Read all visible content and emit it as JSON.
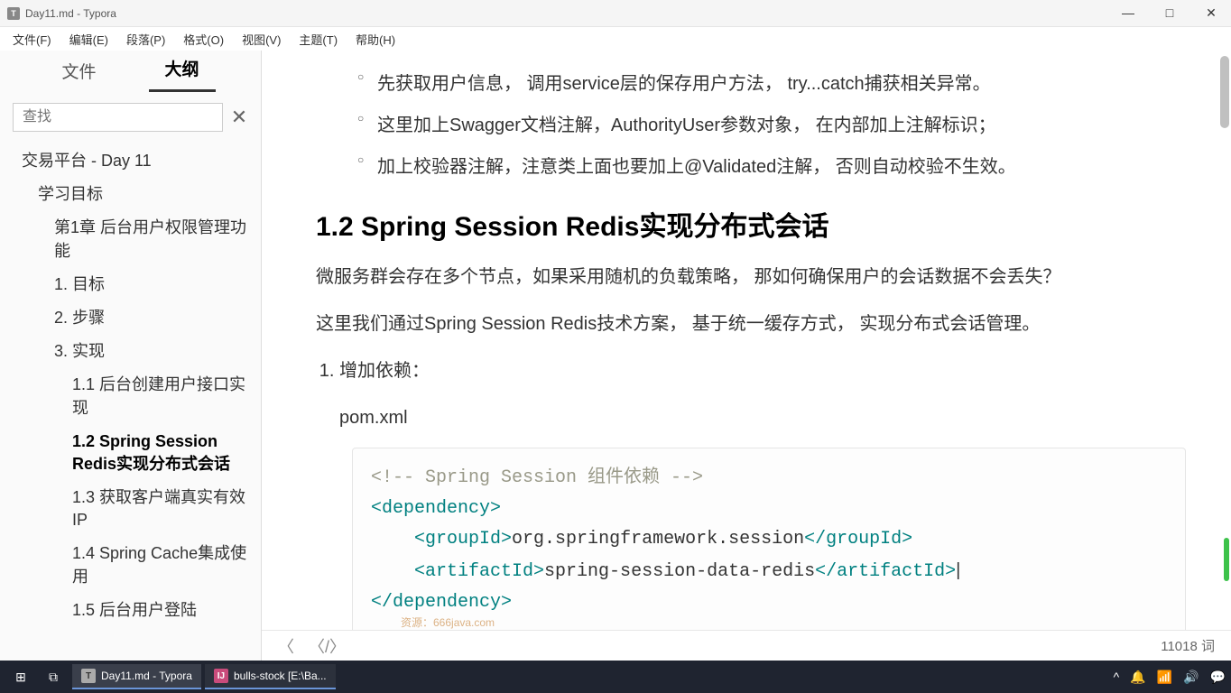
{
  "window": {
    "title": "Day11.md - Typora",
    "icon_letter": "T"
  },
  "menu": {
    "file": "文件(F)",
    "edit": "编辑(E)",
    "paragraph": "段落(P)",
    "format": "格式(O)",
    "view": "视图(V)",
    "theme": "主题(T)",
    "help": "帮助(H)"
  },
  "sidebar": {
    "tab_file": "文件",
    "tab_outline": "大纲",
    "search_placeholder": "查找",
    "outline": [
      {
        "label": "交易平台 - Day 11",
        "level": 1,
        "active": false
      },
      {
        "label": "学习目标",
        "level": 2,
        "active": false
      },
      {
        "label": "第1章 后台用户权限管理功能",
        "level": 3,
        "active": false
      },
      {
        "label": "1. 目标",
        "level": 3,
        "active": false
      },
      {
        "label": "2. 步骤",
        "level": 3,
        "active": false
      },
      {
        "label": "3. 实现",
        "level": 3,
        "active": false
      },
      {
        "label": "1.1 后台创建用户接口实现",
        "level": 4,
        "active": false
      },
      {
        "label": "1.2 Spring Session Redis实现分布式会话",
        "level": 4,
        "active": true
      },
      {
        "label": "1.3 获取客户端真实有效IP",
        "level": 4,
        "active": false
      },
      {
        "label": "1.4 Spring Cache集成使用",
        "level": 4,
        "active": false
      },
      {
        "label": "1.5 后台用户登陆",
        "level": 4,
        "active": false
      }
    ]
  },
  "content": {
    "bullets": [
      "先获取用户信息，  调用service层的保存用户方法，  try...catch捕获相关异常。",
      "这里加上Swagger文档注解，AuthorityUser参数对象，  在内部加上注解标识；",
      "加上校验器注解，注意类上面也要加上@Validated注解，  否则自动校验不生效。"
    ],
    "heading": "1.2 Spring Session Redis实现分布式会话",
    "para1": "微服务群会存在多个节点，如果采用随机的负载策略，  那如何确保用户的会话数据不会丢失？",
    "para2": "这里我们通过Spring Session Redis技术方案，  基于统一缓存方式，  实现分布式会话管理。",
    "ol_item": "增加依赖：",
    "pom_label": "pom.xml",
    "code": {
      "comment_open": "<!-- Spring Session ",
      "comment_cn": "组件依赖",
      "comment_close": " -->",
      "dep_open": "<dependency>",
      "group_open": "<groupId>",
      "group_text": "org.springframework.session",
      "group_close": "</groupId>",
      "art_open": "<artifactId>",
      "art_text": "spring-session-data-redis",
      "art_close": "</artifactId>",
      "dep_close": "</dependency>"
    },
    "watermark": "资源：666java.com"
  },
  "statusbar": {
    "words": "11018 词"
  },
  "taskbar": {
    "app1": "Day11.md - Typora",
    "app2": "bulls-stock [E:\\Ba..."
  }
}
